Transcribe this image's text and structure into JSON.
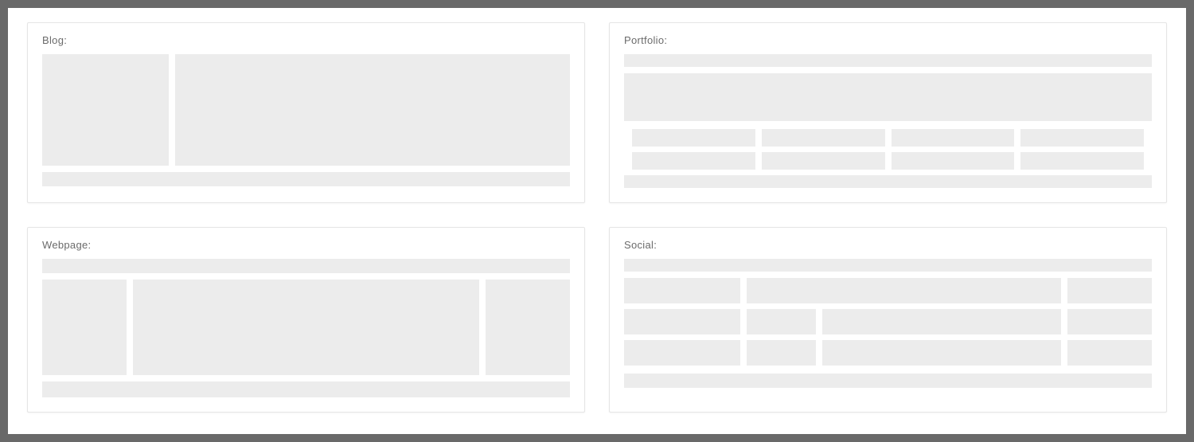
{
  "cards": {
    "blog": {
      "title": "Blog:"
    },
    "portfolio": {
      "title": "Portfolio:"
    },
    "webpage": {
      "title": "Webpage:"
    },
    "social": {
      "title": "Social:"
    }
  }
}
